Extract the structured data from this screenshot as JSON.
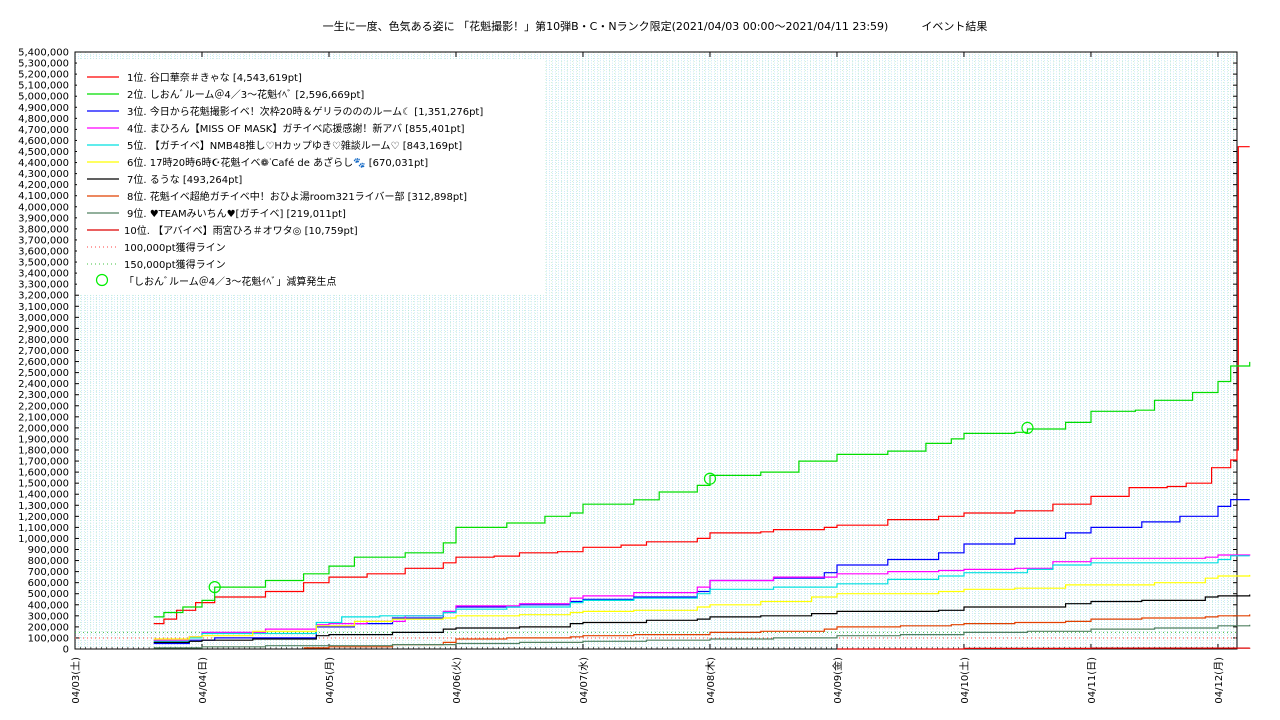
{
  "chart_data": {
    "type": "line",
    "title": "一生に一度、色気ある姿に 「花魁撮影！」第10弾B・C・Nランク限定(2021/04/03 00:00〜2021/04/11 23:59)　　　イベント結果",
    "xlabel": "",
    "ylabel": "",
    "xlim": [
      0,
      9.15
    ],
    "ylim": [
      0,
      5400000
    ],
    "grid": true,
    "legend_position": "top-left",
    "x_tick_labels": [
      "04/03(土)",
      "04/04(日)",
      "04/05(月)",
      "04/06(火)",
      "04/07(水)",
      "04/08(木)",
      "04/09(金)",
      "04/10(土)",
      "04/11(日)",
      "04/12(月)"
    ],
    "y_ticks": [
      0,
      100000,
      200000,
      300000,
      400000,
      500000,
      600000,
      700000,
      800000,
      900000,
      1000000,
      1100000,
      1200000,
      1300000,
      1400000,
      1500000,
      1600000,
      1700000,
      1800000,
      1900000,
      2000000,
      2100000,
      2200000,
      2300000,
      2400000,
      2500000,
      2600000,
      2700000,
      2800000,
      2900000,
      3000000,
      3100000,
      3200000,
      3300000,
      3400000,
      3500000,
      3600000,
      3700000,
      3800000,
      3900000,
      4000000,
      4100000,
      4200000,
      4300000,
      4400000,
      4500000,
      4600000,
      4700000,
      4800000,
      4900000,
      5000000,
      5100000,
      5200000,
      5300000,
      5400000
    ],
    "series": [
      {
        "name": "1位. 谷口華奈＃きゃな [4,543,619pt]",
        "color": "#ff0000",
        "points": [
          [
            0.62,
            230000
          ],
          [
            0.7,
            270000
          ],
          [
            0.8,
            350000
          ],
          [
            0.95,
            420000
          ],
          [
            1.1,
            470000
          ],
          [
            1.4,
            470000
          ],
          [
            1.5,
            520000
          ],
          [
            1.8,
            600000
          ],
          [
            2.0,
            650000
          ],
          [
            2.3,
            680000
          ],
          [
            2.6,
            730000
          ],
          [
            2.9,
            780000
          ],
          [
            3.0,
            830000
          ],
          [
            3.3,
            840000
          ],
          [
            3.5,
            870000
          ],
          [
            3.8,
            880000
          ],
          [
            4.0,
            920000
          ],
          [
            4.3,
            940000
          ],
          [
            4.5,
            970000
          ],
          [
            4.9,
            1000000
          ],
          [
            5.0,
            1050000
          ],
          [
            5.4,
            1060000
          ],
          [
            5.5,
            1080000
          ],
          [
            5.9,
            1100000
          ],
          [
            6.0,
            1120000
          ],
          [
            6.4,
            1170000
          ],
          [
            6.8,
            1200000
          ],
          [
            7.0,
            1230000
          ],
          [
            7.4,
            1250000
          ],
          [
            7.7,
            1310000
          ],
          [
            8.0,
            1380000
          ],
          [
            8.3,
            1460000
          ],
          [
            8.6,
            1470000
          ],
          [
            8.75,
            1500000
          ],
          [
            8.95,
            1640000
          ],
          [
            9.1,
            1710000
          ],
          [
            9.15,
            1800000
          ],
          [
            9.16,
            4543619
          ],
          [
            9.25,
            4543619
          ]
        ]
      },
      {
        "name": "2位. しおんﾞルーム＠4／3〜花魁ｲﾍﾞ [2,596,669pt]",
        "color": "#00dd00",
        "points": [
          [
            0.62,
            290000
          ],
          [
            0.7,
            330000
          ],
          [
            0.85,
            380000
          ],
          [
            1.0,
            440000
          ],
          [
            1.1,
            560000
          ],
          [
            1.45,
            560000
          ],
          [
            1.5,
            620000
          ],
          [
            1.8,
            680000
          ],
          [
            2.0,
            750000
          ],
          [
            2.2,
            830000
          ],
          [
            2.6,
            870000
          ],
          [
            2.9,
            960000
          ],
          [
            3.0,
            1100000
          ],
          [
            3.4,
            1140000
          ],
          [
            3.7,
            1200000
          ],
          [
            3.9,
            1230000
          ],
          [
            4.0,
            1310000
          ],
          [
            4.4,
            1350000
          ],
          [
            4.6,
            1420000
          ],
          [
            4.9,
            1480000
          ],
          [
            5.0,
            1570000
          ],
          [
            5.4,
            1600000
          ],
          [
            5.7,
            1700000
          ],
          [
            6.0,
            1760000
          ],
          [
            6.4,
            1790000
          ],
          [
            6.7,
            1860000
          ],
          [
            6.9,
            1900000
          ],
          [
            7.0,
            1950000
          ],
          [
            7.4,
            1960000
          ],
          [
            7.5,
            1990000
          ],
          [
            7.8,
            2050000
          ],
          [
            8.0,
            2150000
          ],
          [
            8.35,
            2160000
          ],
          [
            8.5,
            2250000
          ],
          [
            8.8,
            2320000
          ],
          [
            9.0,
            2420000
          ],
          [
            9.1,
            2560000
          ],
          [
            9.25,
            2596669
          ]
        ]
      },
      {
        "name": "3位. 今日から花魁撮影イベ！次枠20時＆ゲリラのののルーム☾ [1,351,276pt]",
        "color": "#0000ff",
        "points": [
          [
            0.62,
            50000
          ],
          [
            0.9,
            80000
          ],
          [
            1.1,
            100000
          ],
          [
            1.4,
            100000
          ],
          [
            1.9,
            200000
          ],
          [
            2.2,
            230000
          ],
          [
            2.5,
            280000
          ],
          [
            2.9,
            330000
          ],
          [
            3.0,
            380000
          ],
          [
            3.5,
            400000
          ],
          [
            3.9,
            430000
          ],
          [
            4.0,
            450000
          ],
          [
            4.4,
            470000
          ],
          [
            4.9,
            520000
          ],
          [
            5.0,
            620000
          ],
          [
            5.5,
            640000
          ],
          [
            5.9,
            690000
          ],
          [
            6.0,
            760000
          ],
          [
            6.4,
            810000
          ],
          [
            6.8,
            870000
          ],
          [
            7.0,
            950000
          ],
          [
            7.4,
            1000000
          ],
          [
            7.8,
            1050000
          ],
          [
            8.0,
            1100000
          ],
          [
            8.4,
            1150000
          ],
          [
            8.7,
            1200000
          ],
          [
            9.0,
            1290000
          ],
          [
            9.1,
            1351276
          ],
          [
            9.25,
            1351276
          ]
        ]
      },
      {
        "name": "4位. まひろん【MISS OF MASK】ガチイベ応援感謝！新アバ [855,401pt]",
        "color": "#ff00ff",
        "points": [
          [
            0.62,
            80000
          ],
          [
            0.9,
            110000
          ],
          [
            1.0,
            150000
          ],
          [
            1.4,
            150000
          ],
          [
            1.5,
            180000
          ],
          [
            1.9,
            220000
          ],
          [
            2.0,
            230000
          ],
          [
            2.3,
            250000
          ],
          [
            2.6,
            300000
          ],
          [
            2.9,
            340000
          ],
          [
            3.0,
            390000
          ],
          [
            3.5,
            410000
          ],
          [
            3.9,
            460000
          ],
          [
            4.0,
            480000
          ],
          [
            4.4,
            510000
          ],
          [
            4.9,
            560000
          ],
          [
            5.0,
            620000
          ],
          [
            5.5,
            650000
          ],
          [
            6.0,
            680000
          ],
          [
            6.4,
            700000
          ],
          [
            6.8,
            710000
          ],
          [
            7.0,
            720000
          ],
          [
            7.4,
            730000
          ],
          [
            7.7,
            790000
          ],
          [
            8.0,
            820000
          ],
          [
            8.4,
            820000
          ],
          [
            8.9,
            830000
          ],
          [
            9.0,
            850000
          ],
          [
            9.25,
            855401
          ]
        ]
      },
      {
        "name": "5位. 【ガチイベ】NMB48推し♡Hカップゆき♡雑談ルーム♡ [843,169pt]",
        "color": "#00e0e0",
        "points": [
          [
            0.62,
            70000
          ],
          [
            0.9,
            100000
          ],
          [
            1.0,
            140000
          ],
          [
            1.4,
            140000
          ],
          [
            1.9,
            240000
          ],
          [
            2.1,
            290000
          ],
          [
            2.4,
            300000
          ],
          [
            2.9,
            330000
          ],
          [
            3.0,
            360000
          ],
          [
            3.4,
            380000
          ],
          [
            3.9,
            420000
          ],
          [
            4.0,
            440000
          ],
          [
            4.4,
            460000
          ],
          [
            4.9,
            500000
          ],
          [
            5.0,
            540000
          ],
          [
            5.5,
            560000
          ],
          [
            6.0,
            590000
          ],
          [
            6.4,
            630000
          ],
          [
            6.8,
            660000
          ],
          [
            7.0,
            690000
          ],
          [
            7.5,
            720000
          ],
          [
            7.7,
            760000
          ],
          [
            8.0,
            780000
          ],
          [
            8.4,
            780000
          ],
          [
            8.8,
            780000
          ],
          [
            9.0,
            810000
          ],
          [
            9.1,
            843169
          ],
          [
            9.25,
            843169
          ]
        ]
      },
      {
        "name": "6位. 17時20時6時☪花魁イベ❁ᐝCafé de あざらし🐾 [670,031pt]",
        "color": "#ffff00",
        "points": [
          [
            0.62,
            90000
          ],
          [
            0.9,
            110000
          ],
          [
            1.0,
            120000
          ],
          [
            1.4,
            160000
          ],
          [
            1.9,
            210000
          ],
          [
            2.2,
            250000
          ],
          [
            2.5,
            270000
          ],
          [
            2.9,
            280000
          ],
          [
            3.0,
            300000
          ],
          [
            3.5,
            310000
          ],
          [
            3.9,
            330000
          ],
          [
            4.0,
            340000
          ],
          [
            4.4,
            350000
          ],
          [
            4.9,
            380000
          ],
          [
            5.0,
            400000
          ],
          [
            5.4,
            430000
          ],
          [
            5.8,
            470000
          ],
          [
            6.0,
            500000
          ],
          [
            6.4,
            500000
          ],
          [
            6.8,
            520000
          ],
          [
            7.0,
            540000
          ],
          [
            7.4,
            550000
          ],
          [
            7.8,
            580000
          ],
          [
            8.0,
            580000
          ],
          [
            8.5,
            600000
          ],
          [
            8.9,
            640000
          ],
          [
            9.0,
            660000
          ],
          [
            9.25,
            670031
          ]
        ]
      },
      {
        "name": "7位. るうな [493,264pt]",
        "color": "#000000",
        "points": [
          [
            0.62,
            60000
          ],
          [
            0.9,
            70000
          ],
          [
            1.0,
            80000
          ],
          [
            1.4,
            90000
          ],
          [
            1.9,
            120000
          ],
          [
            2.0,
            130000
          ],
          [
            2.5,
            150000
          ],
          [
            2.9,
            180000
          ],
          [
            3.0,
            190000
          ],
          [
            3.5,
            200000
          ],
          [
            3.9,
            230000
          ],
          [
            4.0,
            240000
          ],
          [
            4.5,
            260000
          ],
          [
            4.9,
            270000
          ],
          [
            5.0,
            290000
          ],
          [
            5.4,
            300000
          ],
          [
            5.8,
            320000
          ],
          [
            6.0,
            340000
          ],
          [
            6.4,
            340000
          ],
          [
            6.8,
            350000
          ],
          [
            7.0,
            380000
          ],
          [
            7.4,
            380000
          ],
          [
            7.8,
            410000
          ],
          [
            8.0,
            430000
          ],
          [
            8.4,
            440000
          ],
          [
            8.9,
            470000
          ],
          [
            9.0,
            480000
          ],
          [
            9.25,
            493264
          ]
        ]
      },
      {
        "name": "8位. 花魁イベ超絶ガチイベ中！おひよ湯room321ライバー部 [312,898pt]",
        "color": "#e04000",
        "points": [
          [
            1.8,
            10000
          ],
          [
            2.0,
            20000
          ],
          [
            2.5,
            40000
          ],
          [
            2.9,
            60000
          ],
          [
            3.0,
            90000
          ],
          [
            3.4,
            100000
          ],
          [
            3.9,
            110000
          ],
          [
            4.0,
            120000
          ],
          [
            4.4,
            130000
          ],
          [
            4.9,
            130000
          ],
          [
            5.0,
            150000
          ],
          [
            5.4,
            160000
          ],
          [
            5.9,
            180000
          ],
          [
            6.0,
            200000
          ],
          [
            6.5,
            210000
          ],
          [
            6.9,
            220000
          ],
          [
            7.0,
            230000
          ],
          [
            7.4,
            240000
          ],
          [
            7.8,
            250000
          ],
          [
            8.0,
            270000
          ],
          [
            8.4,
            280000
          ],
          [
            8.9,
            290000
          ],
          [
            9.0,
            300000
          ],
          [
            9.25,
            312898
          ]
        ]
      },
      {
        "name": "9位. ♥TEAMみいちん♥[ガチイベ] [219,011pt]",
        "color": "#508060",
        "points": [
          [
            0.62,
            10000
          ],
          [
            1.0,
            20000
          ],
          [
            1.5,
            30000
          ],
          [
            2.0,
            30000
          ],
          [
            2.5,
            40000
          ],
          [
            2.9,
            40000
          ],
          [
            3.0,
            50000
          ],
          [
            3.5,
            60000
          ],
          [
            4.0,
            70000
          ],
          [
            4.5,
            80000
          ],
          [
            5.0,
            90000
          ],
          [
            5.5,
            100000
          ],
          [
            6.0,
            120000
          ],
          [
            6.5,
            130000
          ],
          [
            7.0,
            150000
          ],
          [
            7.5,
            160000
          ],
          [
            8.0,
            180000
          ],
          [
            8.5,
            190000
          ],
          [
            9.0,
            210000
          ],
          [
            9.25,
            219011
          ]
        ]
      },
      {
        "name": "10位. 【アバイベ】雨宮ひろ＃オワタ◎ [10,759pt]",
        "color": "#dd0000",
        "points": [
          [
            6.0,
            0
          ],
          [
            7.0,
            5000
          ],
          [
            8.0,
            8000
          ],
          [
            9.25,
            10759
          ]
        ]
      }
    ],
    "reference_lines": [
      {
        "name": "100,000pt獲得ライン",
        "value": 100000,
        "color": "#ff4040"
      },
      {
        "name": "150,000pt獲得ライン",
        "value": 150000,
        "color": "#40c040"
      }
    ],
    "markers": {
      "name": "「しおんﾞルーム＠4／3〜花魁ｲﾍﾞ」減算発生点",
      "color": "#00ee00",
      "points": [
        [
          1.1,
          560000
        ],
        [
          5.0,
          1540000
        ],
        [
          7.5,
          2000000
        ]
      ]
    }
  }
}
